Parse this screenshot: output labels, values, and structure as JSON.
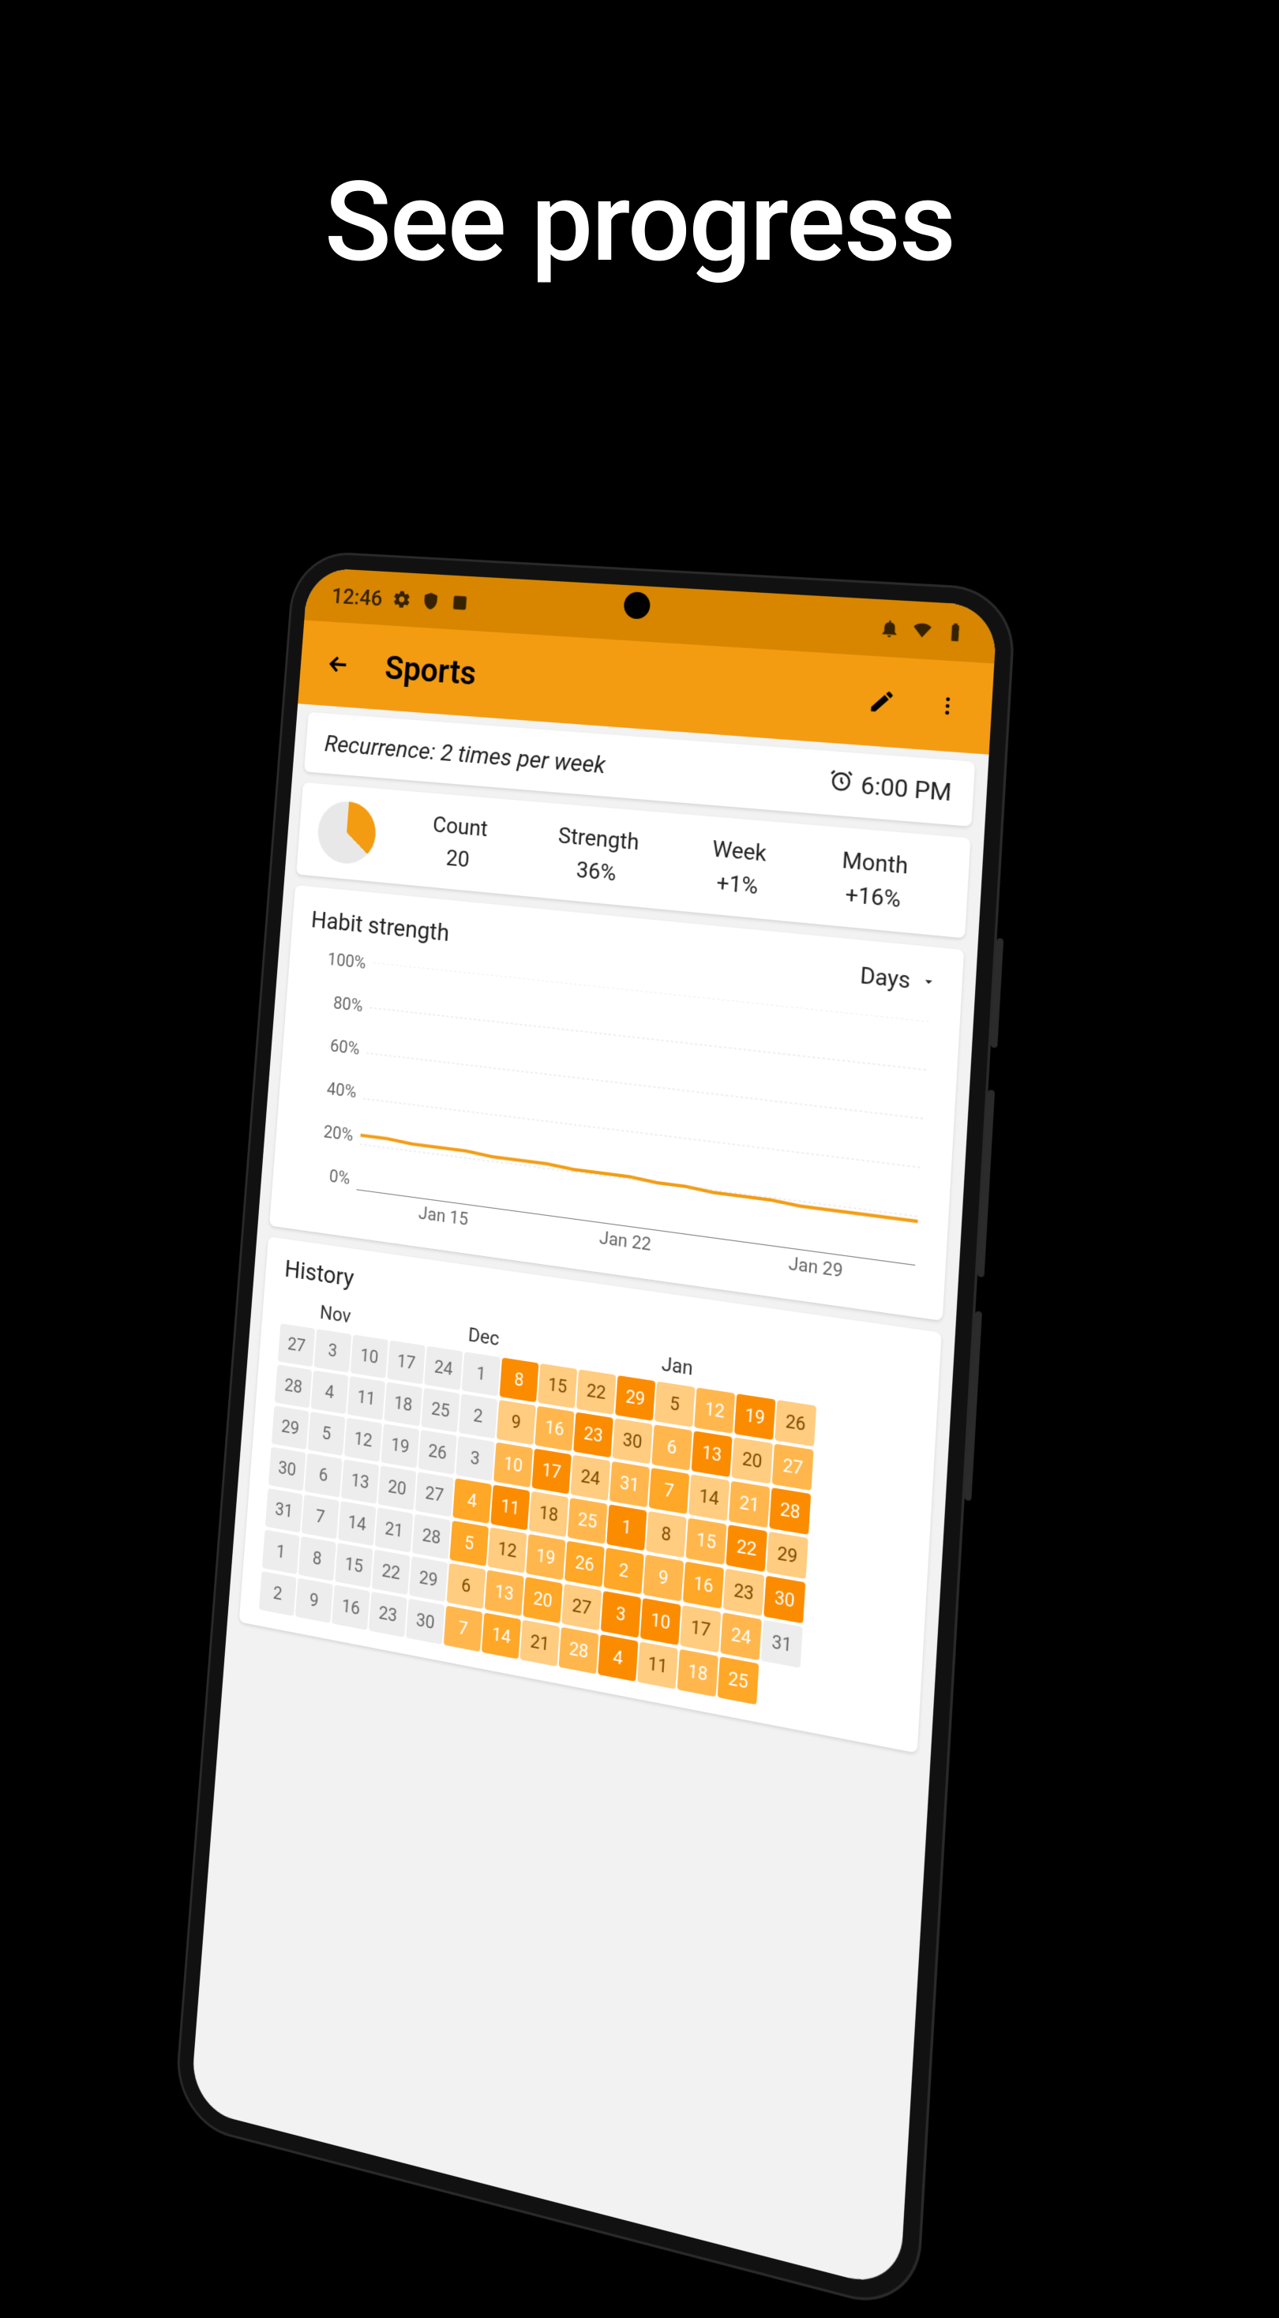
{
  "hero": "See progress",
  "statusbar": {
    "time": "12:46",
    "icons_left": [
      "gear",
      "shield",
      "card"
    ],
    "icons_right": [
      "bell-off",
      "wifi",
      "battery"
    ]
  },
  "appbar": {
    "title": "Sports"
  },
  "recurrence": {
    "text": "Recurrence: 2 times per week",
    "alarm_time": "6:00 PM"
  },
  "stats": {
    "count": {
      "label": "Count",
      "value": "20"
    },
    "strength": {
      "label": "Strength",
      "value": "36%"
    },
    "week": {
      "label": "Week",
      "value": "+1%"
    },
    "month": {
      "label": "Month",
      "value": "+16%"
    }
  },
  "chart": {
    "title": "Habit strength",
    "dropdown": "Days",
    "y_ticks": [
      "100%",
      "80%",
      "60%",
      "40%",
      "20%",
      "0%"
    ],
    "x_ticks": [
      "Jan 15",
      "Jan 22",
      "Jan 29"
    ]
  },
  "chart_data": {
    "type": "line",
    "title": "Habit strength",
    "xlabel": "",
    "ylabel": "",
    "ylim": [
      0,
      100
    ],
    "x": [
      "Jan 11",
      "Jan 12",
      "Jan 13",
      "Jan 14",
      "Jan 15",
      "Jan 16",
      "Jan 17",
      "Jan 18",
      "Jan 19",
      "Jan 20",
      "Jan 21",
      "Jan 22",
      "Jan 23",
      "Jan 24",
      "Jan 25",
      "Jan 26",
      "Jan 27",
      "Jan 28",
      "Jan 29",
      "Jan 30",
      "Jan 31"
    ],
    "values": [
      24,
      24,
      23,
      23,
      23,
      22,
      22,
      22,
      21,
      21,
      21,
      20,
      20,
      19,
      19,
      19,
      18,
      18,
      18,
      18,
      18
    ]
  },
  "history": {
    "title": "History",
    "months": [
      "Nov",
      "Dec",
      "Jan"
    ],
    "columns": [
      {
        "month_label": "",
        "days": [
          {
            "n": 27,
            "lvl": "none"
          },
          {
            "n": 28,
            "lvl": "none"
          },
          {
            "n": 29,
            "lvl": "none"
          },
          {
            "n": 30,
            "lvl": "none"
          },
          {
            "n": 31,
            "lvl": "none"
          },
          {
            "n": 1,
            "lvl": "none"
          },
          {
            "n": 2,
            "lvl": "none"
          }
        ]
      },
      {
        "month_label": "Nov",
        "days": [
          {
            "n": 3,
            "lvl": "none"
          },
          {
            "n": 4,
            "lvl": "none"
          },
          {
            "n": 5,
            "lvl": "none"
          },
          {
            "n": 6,
            "lvl": "none"
          },
          {
            "n": 7,
            "lvl": "none"
          },
          {
            "n": 8,
            "lvl": "none"
          },
          {
            "n": 9,
            "lvl": "none"
          }
        ]
      },
      {
        "month_label": "",
        "days": [
          {
            "n": 10,
            "lvl": "none"
          },
          {
            "n": 11,
            "lvl": "none"
          },
          {
            "n": 12,
            "lvl": "none"
          },
          {
            "n": 13,
            "lvl": "none"
          },
          {
            "n": 14,
            "lvl": "none"
          },
          {
            "n": 15,
            "lvl": "none"
          },
          {
            "n": 16,
            "lvl": "none"
          }
        ]
      },
      {
        "month_label": "",
        "days": [
          {
            "n": 17,
            "lvl": "none"
          },
          {
            "n": 18,
            "lvl": "none"
          },
          {
            "n": 19,
            "lvl": "none"
          },
          {
            "n": 20,
            "lvl": "none"
          },
          {
            "n": 21,
            "lvl": "none"
          },
          {
            "n": 22,
            "lvl": "none"
          },
          {
            "n": 23,
            "lvl": "none"
          }
        ]
      },
      {
        "month_label": "",
        "days": [
          {
            "n": 24,
            "lvl": "none"
          },
          {
            "n": 25,
            "lvl": "none"
          },
          {
            "n": 26,
            "lvl": "none"
          },
          {
            "n": 27,
            "lvl": "none"
          },
          {
            "n": 28,
            "lvl": "none"
          },
          {
            "n": 29,
            "lvl": "none"
          },
          {
            "n": 30,
            "lvl": "none"
          }
        ]
      },
      {
        "month_label": "Dec",
        "days": [
          {
            "n": 1,
            "lvl": "none"
          },
          {
            "n": 2,
            "lvl": "none"
          },
          {
            "n": 3,
            "lvl": "none"
          },
          {
            "n": 4,
            "lvl": "4"
          },
          {
            "n": 5,
            "lvl": "4"
          },
          {
            "n": 6,
            "lvl": "2"
          },
          {
            "n": 7,
            "lvl": "3"
          }
        ]
      },
      {
        "month_label": "",
        "days": [
          {
            "n": 8,
            "lvl": "5"
          },
          {
            "n": 9,
            "lvl": "2"
          },
          {
            "n": 10,
            "lvl": "3"
          },
          {
            "n": 11,
            "lvl": "5"
          },
          {
            "n": 12,
            "lvl": "2"
          },
          {
            "n": 13,
            "lvl": "3"
          },
          {
            "n": 14,
            "lvl": "4"
          }
        ]
      },
      {
        "month_label": "",
        "days": [
          {
            "n": 15,
            "lvl": "2"
          },
          {
            "n": 16,
            "lvl": "3"
          },
          {
            "n": 17,
            "lvl": "5"
          },
          {
            "n": 18,
            "lvl": "2"
          },
          {
            "n": 19,
            "lvl": "3"
          },
          {
            "n": 20,
            "lvl": "4"
          },
          {
            "n": 21,
            "lvl": "2"
          }
        ]
      },
      {
        "month_label": "",
        "days": [
          {
            "n": 22,
            "lvl": "2"
          },
          {
            "n": 23,
            "lvl": "5"
          },
          {
            "n": 24,
            "lvl": "2"
          },
          {
            "n": 25,
            "lvl": "3"
          },
          {
            "n": 26,
            "lvl": "4"
          },
          {
            "n": 27,
            "lvl": "2"
          },
          {
            "n": 28,
            "lvl": "3"
          }
        ]
      },
      {
        "month_label": "",
        "days": [
          {
            "n": 29,
            "lvl": "5"
          },
          {
            "n": 30,
            "lvl": "2"
          },
          {
            "n": 31,
            "lvl": "3"
          },
          {
            "n": 1,
            "lvl": "5"
          },
          {
            "n": 2,
            "lvl": "4"
          },
          {
            "n": 3,
            "lvl": "5"
          },
          {
            "n": 4,
            "lvl": "5"
          }
        ]
      },
      {
        "month_label": "Jan",
        "days": [
          {
            "n": 5,
            "lvl": "2"
          },
          {
            "n": 6,
            "lvl": "3"
          },
          {
            "n": 7,
            "lvl": "4"
          },
          {
            "n": 8,
            "lvl": "2"
          },
          {
            "n": 9,
            "lvl": "3"
          },
          {
            "n": 10,
            "lvl": "5"
          },
          {
            "n": 11,
            "lvl": "2"
          }
        ]
      },
      {
        "month_label": "",
        "days": [
          {
            "n": 12,
            "lvl": "3"
          },
          {
            "n": 13,
            "lvl": "5"
          },
          {
            "n": 14,
            "lvl": "2"
          },
          {
            "n": 15,
            "lvl": "3"
          },
          {
            "n": 16,
            "lvl": "4"
          },
          {
            "n": 17,
            "lvl": "2"
          },
          {
            "n": 18,
            "lvl": "3"
          }
        ]
      },
      {
        "month_label": "",
        "days": [
          {
            "n": 19,
            "lvl": "5"
          },
          {
            "n": 20,
            "lvl": "2"
          },
          {
            "n": 21,
            "lvl": "3"
          },
          {
            "n": 22,
            "lvl": "5"
          },
          {
            "n": 23,
            "lvl": "2"
          },
          {
            "n": 24,
            "lvl": "3"
          },
          {
            "n": 25,
            "lvl": "4"
          }
        ]
      },
      {
        "month_label": "",
        "days": [
          {
            "n": 26,
            "lvl": "2"
          },
          {
            "n": 27,
            "lvl": "3"
          },
          {
            "n": 28,
            "lvl": "5"
          },
          {
            "n": 29,
            "lvl": "2"
          },
          {
            "n": 30,
            "lvl": "5"
          },
          {
            "n": 31,
            "lvl": "none"
          }
        ]
      }
    ]
  }
}
